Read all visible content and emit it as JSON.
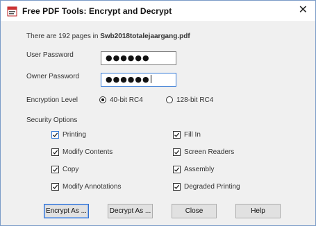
{
  "window": {
    "title": "Free PDF Tools:  Encrypt and Decrypt",
    "close_symbol": "✕",
    "icon": "pdf-app-icon"
  },
  "info": {
    "prefix": "There are 192 pages in ",
    "filename": "Swb2018totalejaargang.pdf"
  },
  "user_password": {
    "label": "User Password",
    "value": "●●●●●●"
  },
  "owner_password": {
    "label": "Owner Password",
    "value": "●●●●●●"
  },
  "encryption": {
    "label": "Encryption Level",
    "options": [
      "40-bit RC4",
      "128-bit RC4"
    ],
    "selected": "40-bit RC4"
  },
  "security": {
    "label": "Security Options",
    "left": [
      {
        "label": "Printing",
        "checked": true
      },
      {
        "label": "Modify Contents",
        "checked": true
      },
      {
        "label": "Copy",
        "checked": true
      },
      {
        "label": "Modify Annotations",
        "checked": true
      }
    ],
    "right": [
      {
        "label": "Fill In",
        "checked": true
      },
      {
        "label": "Screen Readers",
        "checked": true
      },
      {
        "label": "Assembly",
        "checked": true
      },
      {
        "label": "Degraded Printing",
        "checked": true
      }
    ]
  },
  "buttons": {
    "encrypt": "Encrypt As ...",
    "decrypt": "Decrypt As ...",
    "close": "Close",
    "help": "Help"
  },
  "colors": {
    "focus": "#3579d6",
    "titlebar": "#ffffff",
    "client": "#f0f0f0"
  }
}
